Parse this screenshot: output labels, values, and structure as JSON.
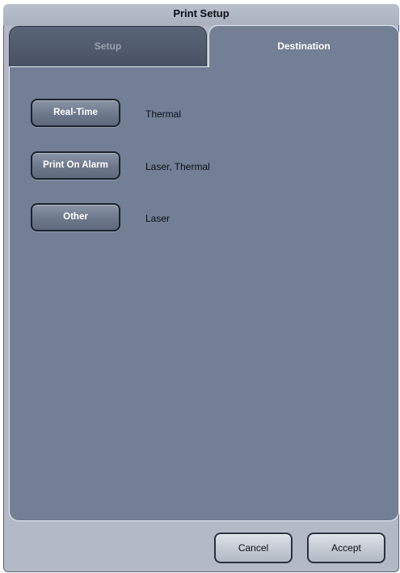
{
  "dialog": {
    "title": "Print Setup"
  },
  "tabs": [
    {
      "label": "Setup",
      "selected": false
    },
    {
      "label": "Destination",
      "selected": true
    }
  ],
  "destinations": [
    {
      "button_label": "Real-Time",
      "value": "Thermal"
    },
    {
      "button_label": "Print On Alarm",
      "value": "Laser, Thermal"
    },
    {
      "button_label": "Other",
      "value": "Laser"
    }
  ],
  "footer": {
    "cancel_label": "Cancel",
    "accept_label": "Accept"
  },
  "colors": {
    "panel": "#727f94",
    "inactive_tab": "#485264",
    "dialog_frame": "#b4bac5"
  }
}
